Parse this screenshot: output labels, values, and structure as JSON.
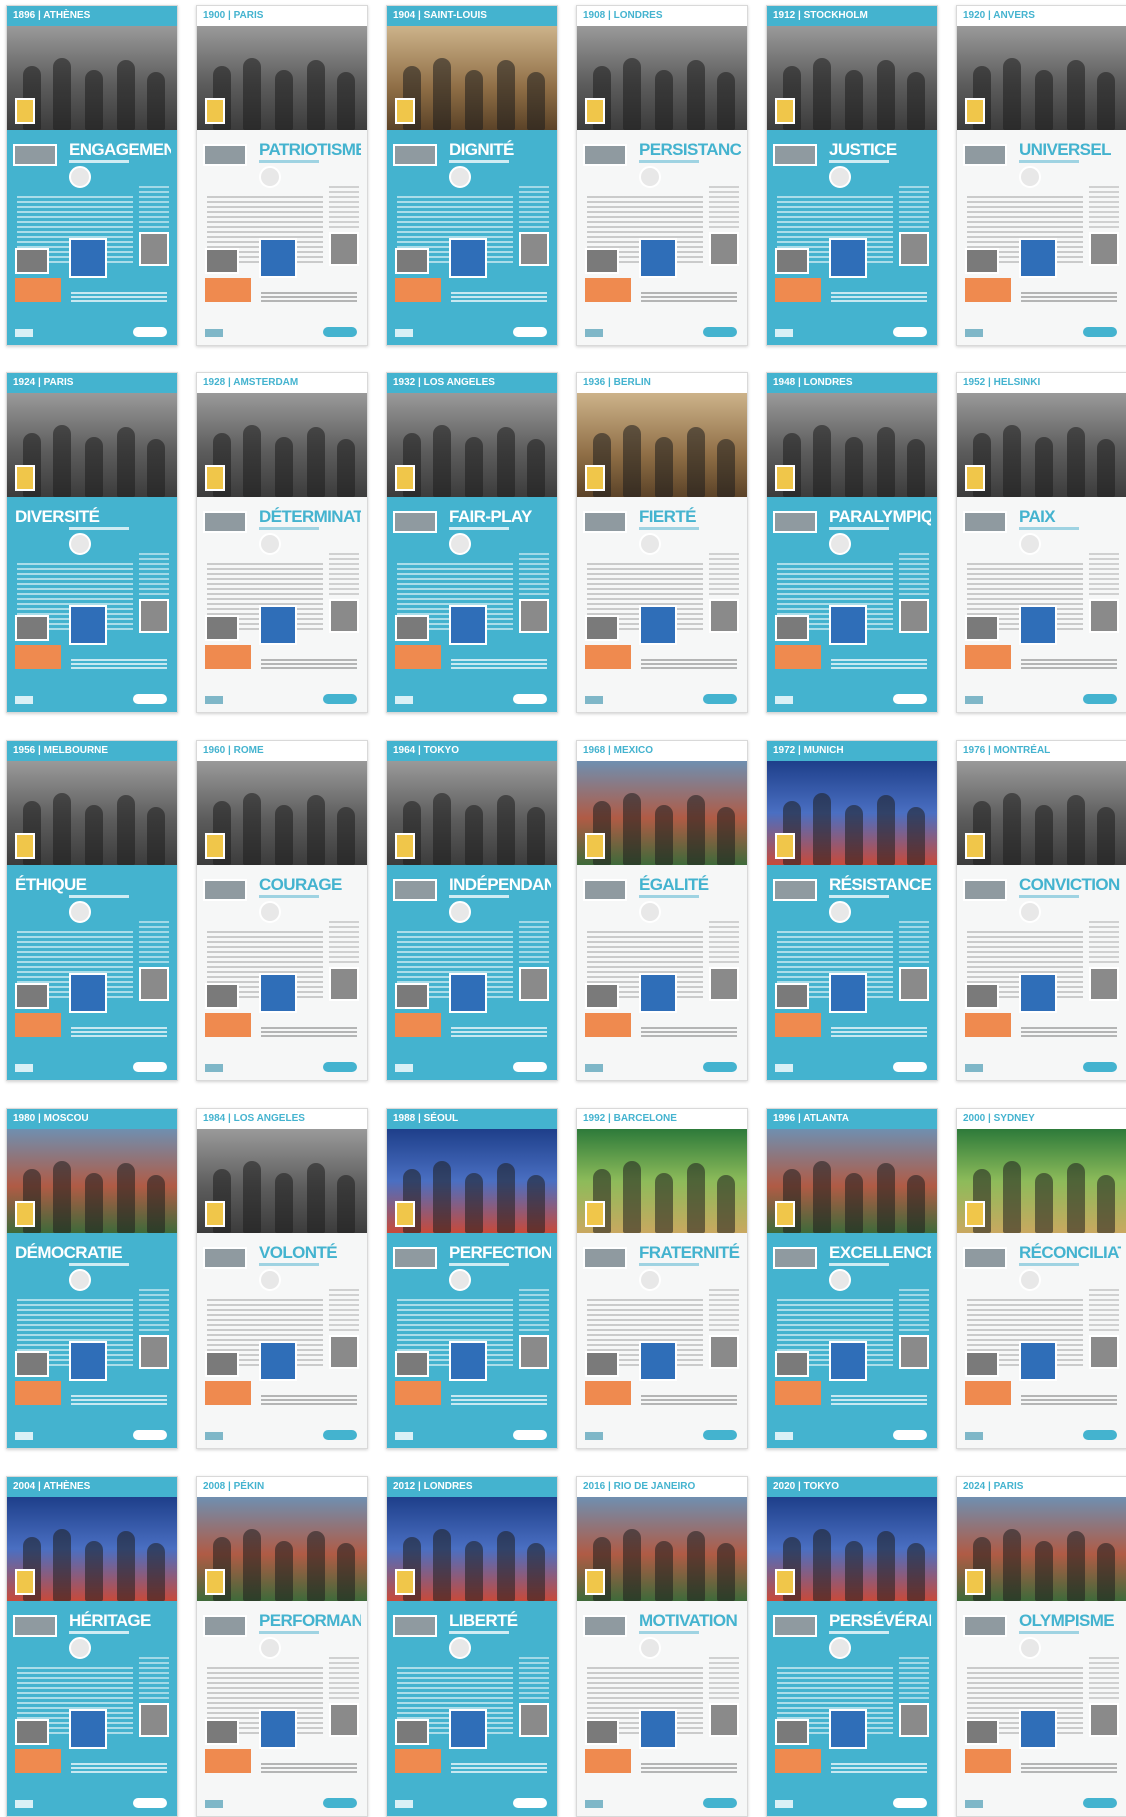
{
  "posters": [
    {
      "year": "1896",
      "city": "ATHÈNES",
      "word": "ENGAGEMENT",
      "theme": "blue",
      "photo": "bw"
    },
    {
      "year": "1900",
      "city": "PARIS",
      "word": "PATRIOTISME",
      "theme": "light",
      "photo": "bw"
    },
    {
      "year": "1904",
      "city": "SAINT-LOUIS",
      "word": "DIGNITÉ",
      "theme": "blue",
      "photo": "sepia"
    },
    {
      "year": "1908",
      "city": "LONDRES",
      "word": "PERSISTANCE",
      "theme": "light",
      "photo": "bw"
    },
    {
      "year": "1912",
      "city": "STOCKHOLM",
      "word": "JUSTICE",
      "theme": "blue",
      "photo": "bw"
    },
    {
      "year": "1920",
      "city": "ANVERS",
      "word": "UNIVERSEL",
      "theme": "light",
      "photo": "bw"
    },
    {
      "year": "1924",
      "city": "PARIS",
      "word": "DIVERSITÉ",
      "theme": "blue",
      "photo": "bw"
    },
    {
      "year": "1928",
      "city": "AMSTERDAM",
      "word": "DÉTERMINATION",
      "theme": "light",
      "photo": "bw"
    },
    {
      "year": "1932",
      "city": "LOS ANGELES",
      "word": "FAIR-PLAY",
      "theme": "blue",
      "photo": "bw"
    },
    {
      "year": "1936",
      "city": "BERLIN",
      "word": "FIERTÉ",
      "theme": "light",
      "photo": "sepia"
    },
    {
      "year": "1948",
      "city": "LONDRES",
      "word": "PARALYMPIQUE",
      "theme": "blue",
      "photo": "bw"
    },
    {
      "year": "1952",
      "city": "HELSINKI",
      "word": "PAIX",
      "theme": "light",
      "photo": "bw"
    },
    {
      "year": "1956",
      "city": "MELBOURNE",
      "word": "ÉTHIQUE",
      "theme": "blue",
      "photo": "bw"
    },
    {
      "year": "1960",
      "city": "ROME",
      "word": "COURAGE",
      "theme": "light",
      "photo": "bw"
    },
    {
      "year": "1964",
      "city": "TOKYO",
      "word": "INDÉPENDANCE",
      "theme": "blue",
      "photo": "bw"
    },
    {
      "year": "1968",
      "city": "MEXICO",
      "word": "ÉGALITÉ",
      "theme": "light",
      "photo": "color"
    },
    {
      "year": "1972",
      "city": "MUNICH",
      "word": "RÉSISTANCE",
      "theme": "blue",
      "photo": "color2"
    },
    {
      "year": "1976",
      "city": "MONTRÉAL",
      "word": "CONVICTION",
      "theme": "light",
      "photo": "bw"
    },
    {
      "year": "1980",
      "city": "MOSCOU",
      "word": "DÉMOCRATIE",
      "theme": "blue",
      "photo": "color"
    },
    {
      "year": "1984",
      "city": "LOS ANGELES",
      "word": "VOLONTÉ",
      "theme": "light",
      "photo": "bw"
    },
    {
      "year": "1988",
      "city": "SÉOUL",
      "word": "PERFECTION",
      "theme": "blue",
      "photo": "color2"
    },
    {
      "year": "1992",
      "city": "BARCELONE",
      "word": "FRATERNITÉ",
      "theme": "light",
      "photo": "color3"
    },
    {
      "year": "1996",
      "city": "ATLANTA",
      "word": "EXCELLENCE",
      "theme": "blue",
      "photo": "color"
    },
    {
      "year": "2000",
      "city": "SYDNEY",
      "word": "RÉCONCILIATION",
      "theme": "light",
      "photo": "color3"
    },
    {
      "year": "2004",
      "city": "ATHÈNES",
      "word": "HÉRITAGE",
      "theme": "blue",
      "photo": "color2"
    },
    {
      "year": "2008",
      "city": "PÉKIN",
      "word": "PERFORMANCE",
      "theme": "light",
      "photo": "color"
    },
    {
      "year": "2012",
      "city": "LONDRES",
      "word": "LIBERTÉ",
      "theme": "blue",
      "photo": "color2"
    },
    {
      "year": "2016",
      "city": "RIO DE JANEIRO",
      "word": "MOTIVATION",
      "theme": "light",
      "photo": "color"
    },
    {
      "year": "2020",
      "city": "TOKYO",
      "word": "PERSÉVÉRANCE",
      "theme": "blue",
      "photo": "color2"
    },
    {
      "year": "2024",
      "city": "PARIS",
      "word": "OLYMPISME",
      "theme": "light",
      "photo": "color"
    }
  ],
  "colors": {
    "accent": "#44b3cf",
    "orange": "#ef8a4f",
    "card_blue": "#2f6eb8"
  }
}
